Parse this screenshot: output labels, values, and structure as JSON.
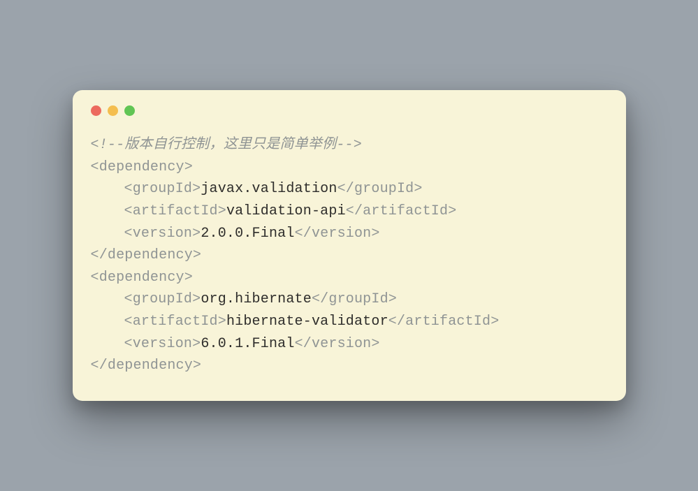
{
  "comment": {
    "open": "<!--",
    "body": "版本自行控制，这里只是简单举例",
    "close": "-->"
  },
  "tags": {
    "dependency_open": "<dependency>",
    "dependency_close": "</dependency>",
    "groupId_open": "<groupId>",
    "groupId_close": "</groupId>",
    "artifactId_open": "<artifactId>",
    "artifactId_close": "</artifactId>",
    "version_open": "<version>",
    "version_close": "</version>"
  },
  "dependencies": [
    {
      "groupId": "javax.validation",
      "artifactId": "validation-api",
      "version": "2.0.0.Final"
    },
    {
      "groupId": "org.hibernate",
      "artifactId": "hibernate-validator",
      "version": "6.0.1.Final"
    }
  ],
  "colors": {
    "window_bg": "#f8f4d8",
    "page_bg": "#9ba3ab",
    "tag_fg": "#8f9494",
    "text_fg": "#2e2d2b"
  }
}
